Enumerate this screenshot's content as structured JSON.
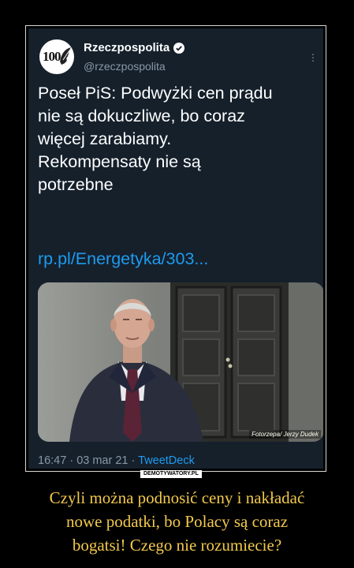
{
  "tweet": {
    "avatar_text": "100",
    "name": "Rzeczpospolita",
    "handle": "@rzeczpospolita",
    "text_lines": [
      "Poseł PiS: Podwyżki cen prądu",
      "nie są dokuczliwe, bo coraz",
      "więcej zarabiamy.",
      "Rekompensaty nie są",
      "potrzebne"
    ],
    "link": "rp.pl/Energetyka/303...",
    "photo_credit": "Fotorzepa/ Jerzy Dudek",
    "time": "16:47",
    "date": "03 mar 21",
    "source": "TweetDeck",
    "colors": {
      "background": "#15202b",
      "link": "#1d9bf0",
      "muted": "#8b98a5",
      "verified": "#ffffff"
    }
  },
  "watermark": "DEMOTYWATORY.PL",
  "caption_lines": [
    "Czyli można podnosić ceny i nakładać",
    "nowe podatki, bo Polacy są coraz",
    "bogatsi! Czego nie rozumiecie?"
  ],
  "caption_color": "#f2c94c"
}
